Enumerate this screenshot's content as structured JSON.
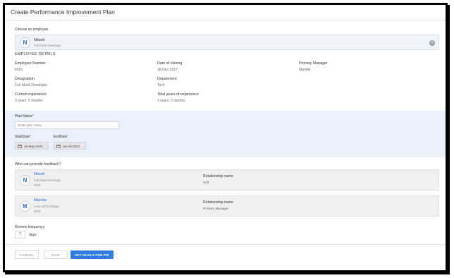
{
  "header": {
    "title": "Create Performance Improvement Plan"
  },
  "employee_picker": {
    "label": "Choose an employee",
    "selected": {
      "initial": "N",
      "name": "Nitesh",
      "role": "Full Stack Developer"
    }
  },
  "details": {
    "title": "EMPLOYEE DETAILS",
    "fields": [
      {
        "label": "Employee Number",
        "value": "6029"
      },
      {
        "label": "Date of Joining",
        "value": "18-Dec-2017"
      },
      {
        "label": "Primary Manager",
        "value": "Mandar"
      },
      {
        "label": "Designation",
        "value": "Full Stack Developer"
      },
      {
        "label": "Department",
        "value": "Tech"
      },
      {
        "label": "Current experience",
        "value": "3 years, 5 months"
      },
      {
        "label": "Total years of experience",
        "value": "3 years, 5 months"
      }
    ]
  },
  "plan": {
    "name_label": "Plan Name",
    "name_placeholder": "Enter plan name",
    "start_label": "StartDate",
    "start_value": "19-May-2021",
    "end_label": "EndDate",
    "end_value": "18-Jul-2021",
    "required_mark": "*"
  },
  "feedback": {
    "title": "Who can provide feedback?",
    "rel_label": "Relationship name",
    "providers": [
      {
        "initial": "N",
        "name": "Nitesh",
        "role": "Full Stack Developer",
        "id": "6029",
        "relationship": "Self"
      },
      {
        "initial": "M",
        "name": "Mandar",
        "role": "Lead UI/UX Design",
        "id": "6234",
        "relationship": "Primary Manager"
      }
    ]
  },
  "review": {
    "label": "Review frequency",
    "value": "7",
    "unit": "days"
  },
  "actions": {
    "cancel": "CANCEL",
    "save": "SAVE",
    "goals": "SET GOALS FOR PIP"
  },
  "colors": {
    "accent": "#2e7dde",
    "band": "#e9f0fa"
  }
}
